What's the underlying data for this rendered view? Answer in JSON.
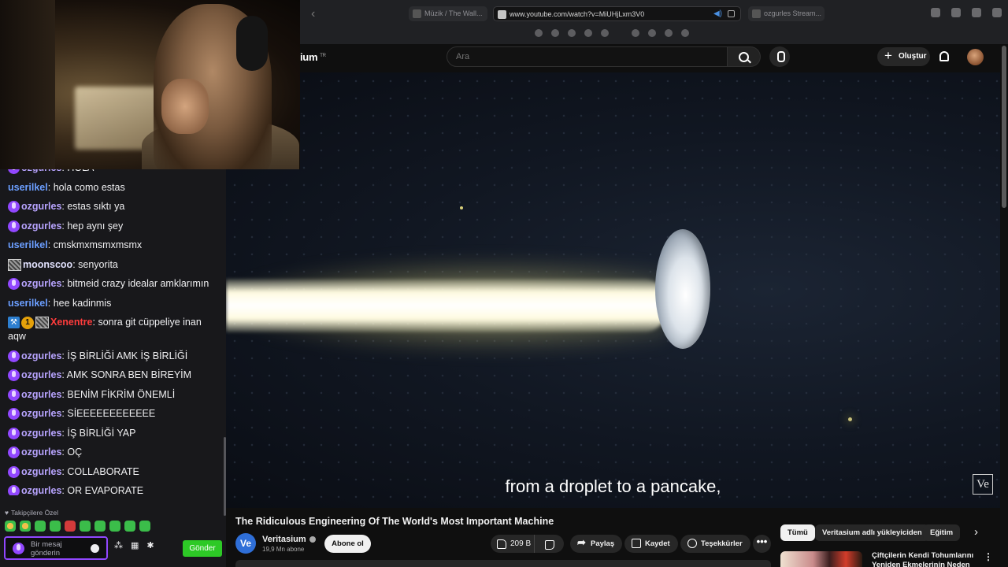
{
  "browser": {
    "tabs": [
      {
        "label": "Müzik / The Wall...",
        "active": false
      },
      {
        "label": "www.youtube.com/watch?v=MiUHjLxm3V0",
        "active": true
      },
      {
        "label": "ozgurles Stream...",
        "active": false
      }
    ]
  },
  "youtube": {
    "logo_text": "ium",
    "logo_region": "TR",
    "search_placeholder": "Ara",
    "create_label": "Oluştur",
    "video": {
      "subtitle": "from a droplet to a pancake,",
      "watermark": "Ve"
    },
    "title": "The Ridiculous Engineering Of The World's Most Important Machine",
    "channel": {
      "avatar_text": "Ve",
      "name": "Veritasium",
      "subscribers": "19,9 Mn abone",
      "subscribe_label": "Abone ol"
    },
    "actions": {
      "likes": "209 B",
      "share": "Paylaş",
      "save": "Kaydet",
      "thanks": "Teşekkürler",
      "more": "•••"
    },
    "chips": [
      "Tümü",
      "Veritasium adlı yükleyiciden",
      "Eğitim"
    ],
    "recommendation_title": "Çiftçilerin Kendi Tohumlarını Yeniden Ekmelerinin Neden"
  },
  "chat": {
    "messages": [
      {
        "user": "ozgurles",
        "color": "purple",
        "text": "HOLA",
        "badges": [
          "mic"
        ]
      },
      {
        "user": "userilkel",
        "color": "blue",
        "text": "hola como estas",
        "badges": []
      },
      {
        "user": "ozgurles",
        "color": "purple",
        "text": "estas sıktı ya",
        "badges": [
          "mic"
        ]
      },
      {
        "user": "ozgurles",
        "color": "purple",
        "text": "hep aynı şey",
        "badges": [
          "mic"
        ]
      },
      {
        "user": "userilkel",
        "color": "blue",
        "text": "cmskmxmsmxmsmx",
        "badges": []
      },
      {
        "user": "moonscoo",
        "color": "white",
        "text": "senyorita",
        "badges": [
          "img"
        ]
      },
      {
        "user": "ozgurles",
        "color": "purple",
        "text": "bitmeid crazy idealar amklarımın",
        "badges": [
          "mic"
        ]
      },
      {
        "user": "userilkel",
        "color": "blue",
        "text": "hee kadinmis",
        "badges": []
      },
      {
        "user": "Xenentre",
        "color": "red",
        "text": "sonra git cüppeliye inan aqw",
        "badges": [
          "blue",
          "num",
          "img"
        ]
      },
      {
        "user": "ozgurles",
        "color": "purple",
        "text": "İŞ BİRLİĞİ AMK İŞ BİRLİĞİ",
        "badges": [
          "mic"
        ]
      },
      {
        "user": "ozgurles",
        "color": "purple",
        "text": "AMK SONRA BEN BİREYİM",
        "badges": [
          "mic"
        ]
      },
      {
        "user": "ozgurles",
        "color": "purple",
        "text": "BENİM FİKRİM ÖNEMLİ",
        "badges": [
          "mic"
        ]
      },
      {
        "user": "ozgurles",
        "color": "purple",
        "text": "SİEEEEEEEEEEEE",
        "badges": [
          "mic"
        ]
      },
      {
        "user": "ozgurles",
        "color": "purple",
        "text": "İŞ BİRLİĞİ YAP",
        "badges": [
          "mic"
        ]
      },
      {
        "user": "ozgurles",
        "color": "purple",
        "text": "OÇ",
        "badges": [
          "mic"
        ]
      },
      {
        "user": "ozgurles",
        "color": "purple",
        "text": "COLLABORATE",
        "badges": [
          "mic"
        ]
      },
      {
        "user": "ozgurles",
        "color": "purple",
        "text": "OR EVAPORATE",
        "badges": [
          "mic"
        ]
      }
    ],
    "badge_number": "1",
    "followers_only": "Takipçilere Özel",
    "input_placeholder": "Bir mesaj gönderin",
    "send_label": "Gönder"
  }
}
